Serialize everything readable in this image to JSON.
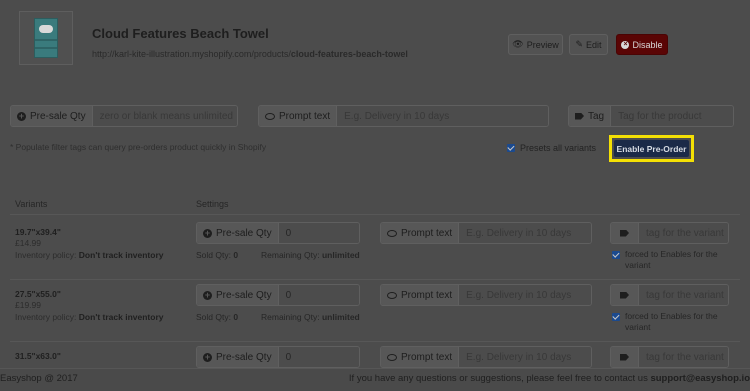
{
  "product": {
    "title": "Cloud Features Beach Towel",
    "url_prefix": "http://karl-kite-illustration.myshopify.com/products/",
    "url_slug": "cloud-features-beach-towel"
  },
  "actions": {
    "preview": "Preview",
    "edit": "Edit",
    "disable": "Disable"
  },
  "filters": {
    "presale_label": "Pre-sale Qty",
    "presale_placeholder": "zero or blank means unlimited",
    "prompt_label": "Prompt text",
    "prompt_placeholder": "E.g. Delivery in 10 days",
    "tag_label": "Tag",
    "tag_placeholder": "Tag for the product"
  },
  "hint": "* Populate filter tags can query pre-orders product quickly in Shopify",
  "presets_all_variants": "Presets all variants",
  "enable_button": "Enable Pre-Order",
  "table": {
    "col_variants": "Variants",
    "col_settings": "Settings"
  },
  "labels": {
    "presale_qty": "Pre-sale Qty",
    "prompt_text": "Prompt text",
    "prompt_placeholder": "E.g. Delivery in 10 days",
    "tag_placeholder": "tag for the variant",
    "inventory_policy": "Inventory policy:",
    "sold_qty": "Sold Qty:",
    "remaining_qty": "Remaining Qty:",
    "forced": "forced to Enables for the variant"
  },
  "variants": [
    {
      "name": "19.7\"x39.4\"",
      "price": "£14.99",
      "policy": "Don't track inventory",
      "qty": "0",
      "sold": "0",
      "remaining": "unlimited"
    },
    {
      "name": "27.5\"x55.0\"",
      "price": "£19.99",
      "policy": "Don't track inventory",
      "qty": "0",
      "sold": "0",
      "remaining": "unlimited"
    },
    {
      "name": "31.5\"x63.0\"",
      "qty": "0"
    }
  ],
  "footer": {
    "left": "Easyshop @ 2017",
    "right_text": "If you have any questions or suggestions, please feel free to contact us",
    "email": "support@easyshop.io"
  },
  "colors": {
    "overlay": "#4c4c4c",
    "highlight": "#f4e004",
    "enable_button": "#1b2a48",
    "disable_button": "#5a0505",
    "checkbox": "#1b4a8f"
  }
}
